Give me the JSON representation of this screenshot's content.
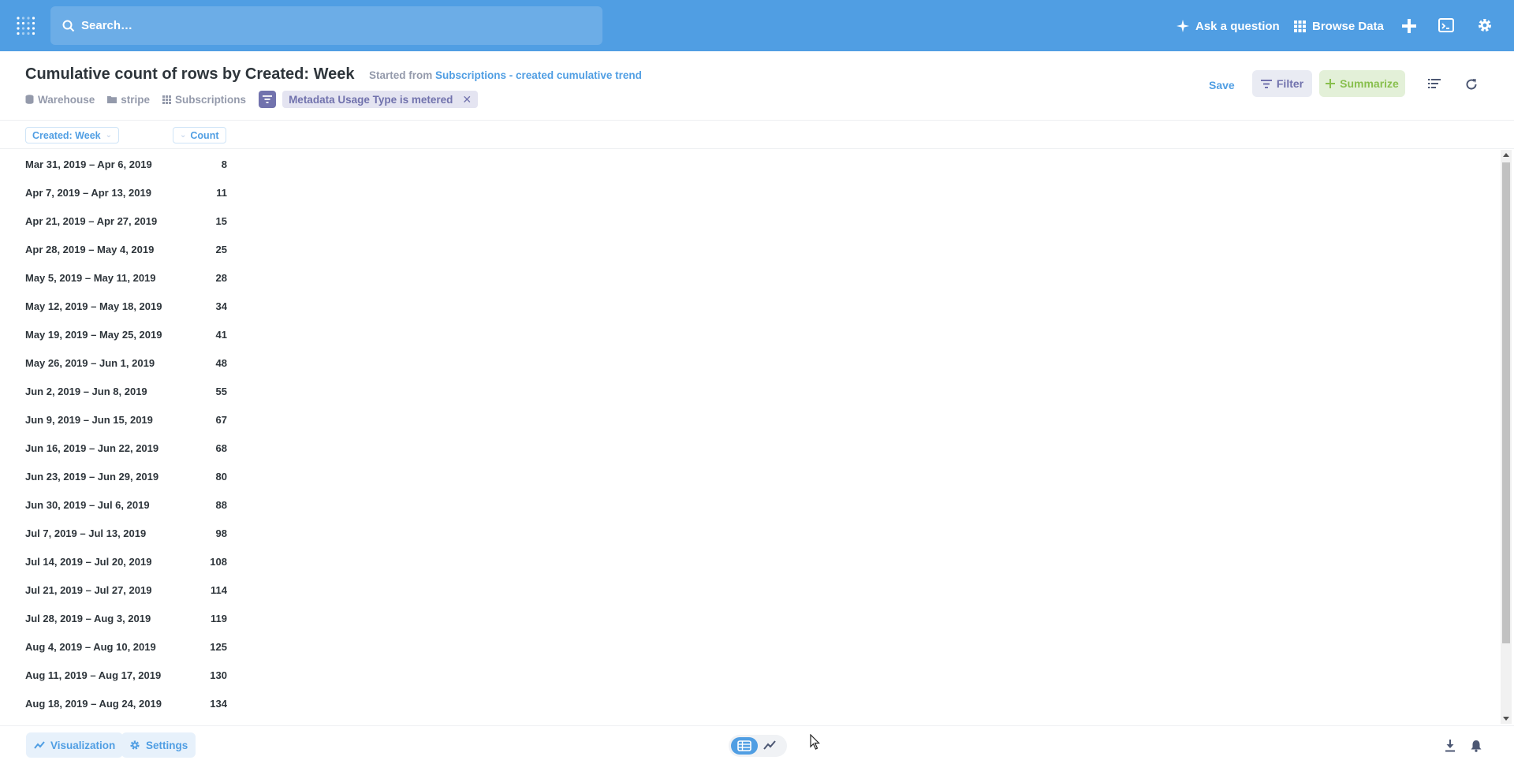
{
  "nav": {
    "search_placeholder": "Search…",
    "ask_question": "Ask a question",
    "browse_data": "Browse Data"
  },
  "header": {
    "title": "Cumulative count of rows by Created: Week",
    "started_from_prefix": "Started from",
    "started_from_link": "Subscriptions - created cumulative trend",
    "breadcrumbs": [
      "Warehouse",
      "stripe",
      "Subscriptions"
    ],
    "filter_pill": "Metadata Usage Type is metered",
    "save_label": "Save",
    "filter_label": "Filter",
    "summarize_label": "Summarize"
  },
  "table": {
    "columns": [
      "Created: Week",
      "Count"
    ],
    "rows": [
      {
        "week": "Mar 31, 2019 – Apr 6, 2019",
        "count": "8"
      },
      {
        "week": "Apr 7, 2019 – Apr 13, 2019",
        "count": "11"
      },
      {
        "week": "Apr 21, 2019 – Apr 27, 2019",
        "count": "15"
      },
      {
        "week": "Apr 28, 2019 – May 4, 2019",
        "count": "25"
      },
      {
        "week": "May 5, 2019 – May 11, 2019",
        "count": "28"
      },
      {
        "week": "May 12, 2019 – May 18, 2019",
        "count": "34"
      },
      {
        "week": "May 19, 2019 – May 25, 2019",
        "count": "41"
      },
      {
        "week": "May 26, 2019 – Jun 1, 2019",
        "count": "48"
      },
      {
        "week": "Jun 2, 2019 – Jun 8, 2019",
        "count": "55"
      },
      {
        "week": "Jun 9, 2019 – Jun 15, 2019",
        "count": "67"
      },
      {
        "week": "Jun 16, 2019 – Jun 22, 2019",
        "count": "68"
      },
      {
        "week": "Jun 23, 2019 – Jun 29, 2019",
        "count": "80"
      },
      {
        "week": "Jun 30, 2019 – Jul 6, 2019",
        "count": "88"
      },
      {
        "week": "Jul 7, 2019 – Jul 13, 2019",
        "count": "98"
      },
      {
        "week": "Jul 14, 2019 – Jul 20, 2019",
        "count": "108"
      },
      {
        "week": "Jul 21, 2019 – Jul 27, 2019",
        "count": "114"
      },
      {
        "week": "Jul 28, 2019 – Aug 3, 2019",
        "count": "119"
      },
      {
        "week": "Aug 4, 2019 – Aug 10, 2019",
        "count": "125"
      },
      {
        "week": "Aug 11, 2019 – Aug 17, 2019",
        "count": "130"
      },
      {
        "week": "Aug 18, 2019 – Aug 24, 2019",
        "count": "134"
      }
    ]
  },
  "footer": {
    "visualization_label": "Visualization",
    "settings_label": "Settings"
  },
  "colors": {
    "brand": "#509ee3",
    "filter": "#7172ad",
    "summarize": "#88bf4d",
    "text_dark": "#2e353b"
  },
  "icons": [
    "metabase-logo-icon",
    "search-icon",
    "sparkle-icon",
    "grid-icon",
    "plus-icon",
    "terminal-icon",
    "gear-icon",
    "database-icon",
    "folder-icon",
    "table-icon",
    "filter-icon",
    "close-icon",
    "list-icon",
    "refresh-icon",
    "line-chart-icon",
    "download-icon",
    "bell-icon"
  ]
}
